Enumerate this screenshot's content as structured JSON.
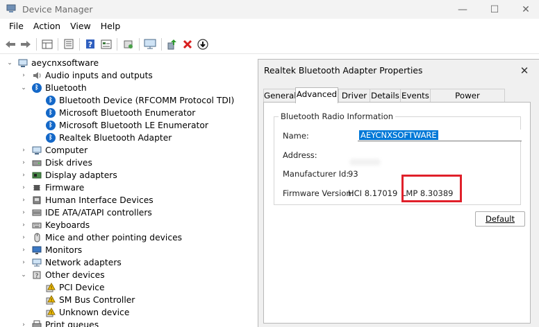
{
  "window": {
    "title": "Device Manager",
    "controls": {
      "minimize": "—",
      "maximize": "☐",
      "close": "✕"
    }
  },
  "menu": [
    "File",
    "Action",
    "View",
    "Help"
  ],
  "toolbar": {
    "icons": [
      "back-icon",
      "forward-icon",
      "properties-grid-icon",
      "list-icon",
      "help-icon",
      "view-icon",
      "scan-hardware-icon",
      "monitor-icon",
      "update-driver-icon",
      "uninstall-icon",
      "disable-icon"
    ]
  },
  "tree": {
    "root": "aeycnxsoftware",
    "items": [
      {
        "label": "Audio inputs and outputs",
        "icon": "speaker-icon"
      },
      {
        "label": "Bluetooth",
        "icon": "bluetooth-icon",
        "expanded": true,
        "children": [
          "Bluetooth Device (RFCOMM Protocol TDI)",
          "Microsoft Bluetooth Enumerator",
          "Microsoft Bluetooth LE Enumerator",
          "Realtek Bluetooth Adapter"
        ]
      },
      {
        "label": "Computer",
        "icon": "computer-icon"
      },
      {
        "label": "Disk drives",
        "icon": "disk-icon"
      },
      {
        "label": "Display adapters",
        "icon": "display-adapter-icon"
      },
      {
        "label": "Firmware",
        "icon": "chip-icon"
      },
      {
        "label": "Human Interface Devices",
        "icon": "hid-icon"
      },
      {
        "label": "IDE ATA/ATAPI controllers",
        "icon": "ide-icon"
      },
      {
        "label": "Keyboards",
        "icon": "keyboard-icon"
      },
      {
        "label": "Mice and other pointing devices",
        "icon": "mouse-icon"
      },
      {
        "label": "Monitors",
        "icon": "monitor-icon"
      },
      {
        "label": "Network adapters",
        "icon": "network-icon"
      },
      {
        "label": "Other devices",
        "icon": "other-devices-icon",
        "expanded": true,
        "children": [
          "PCI Device",
          "SM Bus Controller",
          "Unknown device"
        ]
      },
      {
        "label": "Print queues",
        "icon": "printer-icon"
      }
    ]
  },
  "dialog": {
    "title": "Realtek Bluetooth Adapter Properties",
    "close": "✕",
    "tabs": [
      "General",
      "Advanced",
      "Driver",
      "Details",
      "Events",
      "Power Management"
    ],
    "active_tab": "Advanced",
    "group_title": "Bluetooth Radio Information",
    "fields": {
      "name_label": "Name:",
      "name_value": "AEYCNXSOFTWARE",
      "address_label": "Address:",
      "manufacturer_label": "Manufacturer Id:",
      "manufacturer_value": "93",
      "firmware_label": "Firmware Version:",
      "firmware_hci": "HCI 8.17019",
      "firmware_lmp": "LMP 8.30389"
    },
    "default_button": "Default",
    "highlight_color": "#e0202a"
  }
}
